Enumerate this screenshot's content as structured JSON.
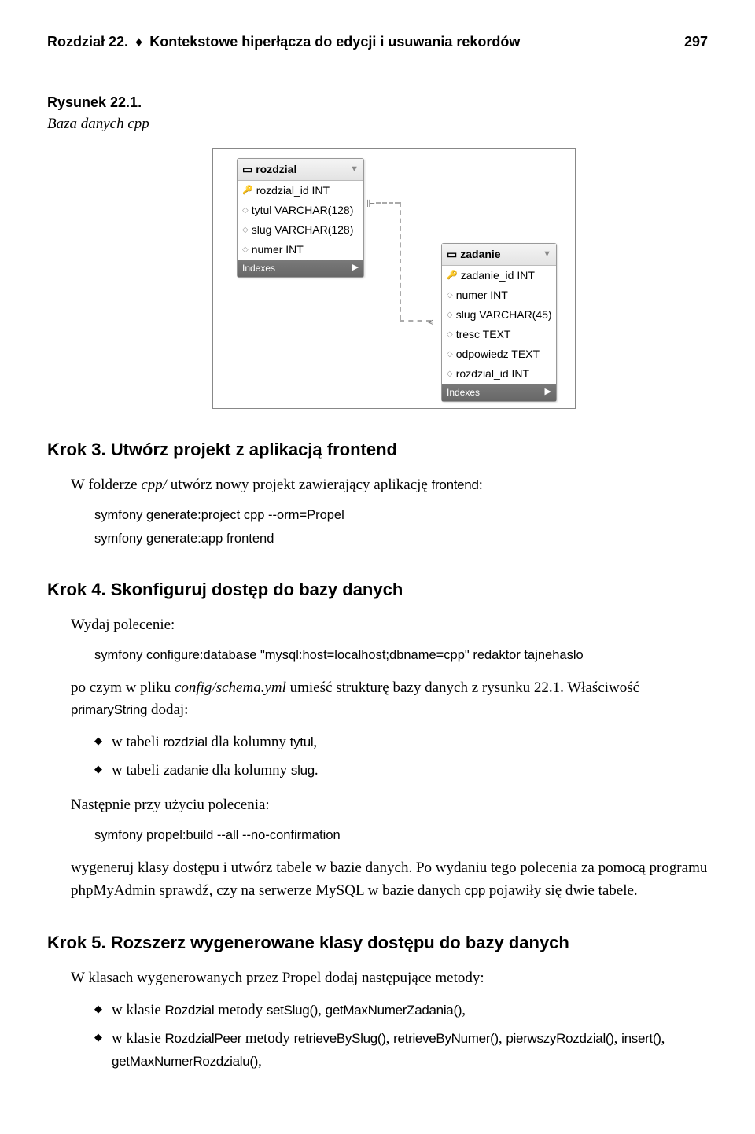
{
  "header": {
    "chapter": "Rozdział 22.",
    "diamond": "♦",
    "title": "Kontekstowe hiperłącza do edycji i usuwania rekordów",
    "page": "297"
  },
  "fig": {
    "label": "Rysunek 22.1.",
    "caption": "Baza danych cpp",
    "table1": {
      "name": "rozdzial",
      "cols": [
        "rozdzial_id INT",
        "tytul VARCHAR(128)",
        "slug VARCHAR(128)",
        "numer INT"
      ],
      "indexes": "Indexes"
    },
    "table2": {
      "name": "zadanie",
      "cols": [
        "zadanie_id INT",
        "numer INT",
        "slug VARCHAR(45)",
        "tresc TEXT",
        "odpowiedz TEXT",
        "rozdzial_id INT"
      ],
      "indexes": "Indexes"
    }
  },
  "krok3": {
    "title": "Krok 3. Utwórz projekt z aplikacją frontend",
    "p1a": "W folderze ",
    "p1b": "cpp/",
    "p1c": " utwórz nowy projekt zawierający aplikację ",
    "p1d": "frontend",
    "p1e": ":",
    "code1": "symfony generate:project cpp --orm=Propel",
    "code2": "symfony generate:app frontend"
  },
  "krok4": {
    "title": "Krok 4. Skonfiguruj dostęp do bazy danych",
    "p1": "Wydaj polecenie:",
    "code1": "symfony configure:database \"mysql:host=localhost;dbname=cpp\" redaktor tajnehaslo",
    "p2a": "po czym w pliku ",
    "p2b": "config/schema.yml",
    "p2c": " umieść strukturę bazy danych z rysunku 22.1. Właściwość ",
    "p2d": "primaryString",
    "p2e": " dodaj:",
    "li1a": "w tabeli ",
    "li1b": "rozdzial",
    "li1c": " dla kolumny ",
    "li1d": "tytul",
    "li1e": ",",
    "li2a": "w tabeli ",
    "li2b": "zadanie",
    "li2c": " dla kolumny ",
    "li2d": "slug",
    "li2e": ".",
    "p3": "Następnie przy użyciu polecenia:",
    "code2": "symfony propel:build --all --no-confirmation",
    "p4a": "wygeneruj klasy dostępu i utwórz tabele w bazie danych. Po wydaniu tego polecenia za pomocą programu phpMyAdmin sprawdź, czy na serwerze MySQL w bazie danych ",
    "p4b": "cpp",
    "p4c": " pojawiły się dwie tabele."
  },
  "krok5": {
    "title": "Krok 5. Rozszerz wygenerowane klasy dostępu do bazy danych",
    "p1": "W klasach wygenerowanych przez Propel dodaj następujące metody:",
    "li1a": "w klasie ",
    "li1b": "Rozdzial",
    "li1c": " metody ",
    "li1d": "setSlug()",
    "li1e": ", ",
    "li1f": "getMaxNumerZadania()",
    "li1g": ",",
    "li2a": "w klasie ",
    "li2b": "RozdzialPeer",
    "li2c": " metody ",
    "li2d": "retrieveBySlug()",
    "li2e": ", ",
    "li2f": "retrieveByNumer()",
    "li2g": ", ",
    "li2h": "pierwszyRozdzial()",
    "li2i": ", ",
    "li2j": "insert()",
    "li2k": ", ",
    "li2l": "getMaxNumerRozdzialu()",
    "li2m": ","
  }
}
